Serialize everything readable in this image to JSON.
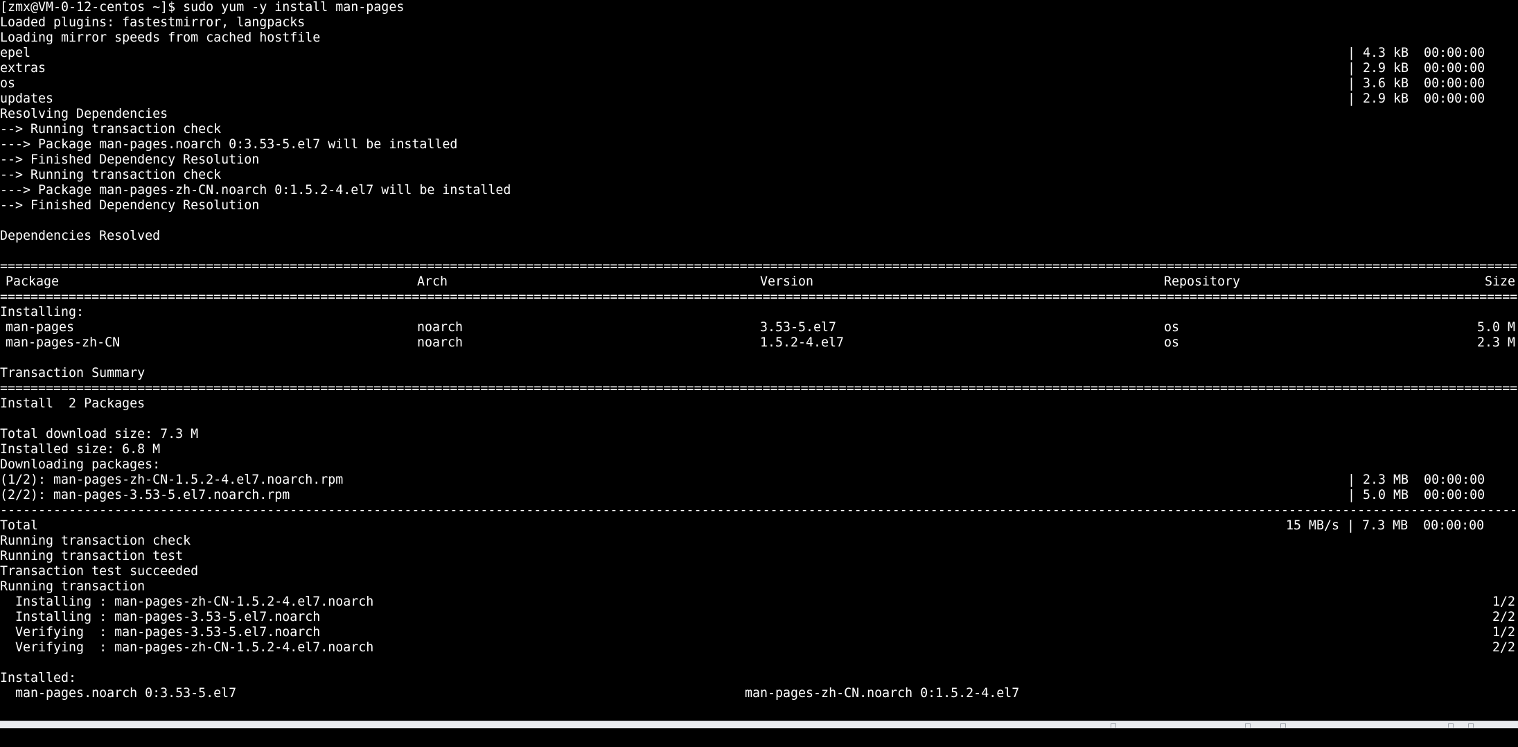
{
  "terminal": {
    "prompt": "[zmx@VM-0-12-centos ~]$ sudo yum -y install man-pages",
    "loaded_plugins": "Loaded plugins: fastestmirror, langpacks",
    "mirror_msg": "Loading mirror speeds from cached hostfile",
    "repos": [
      {
        "name": "epel",
        "stat": "| 4.3 kB  00:00:00"
      },
      {
        "name": "extras",
        "stat": "| 2.9 kB  00:00:00"
      },
      {
        "name": "os",
        "stat": "| 3.6 kB  00:00:00"
      },
      {
        "name": "updates",
        "stat": "| 2.9 kB  00:00:00"
      }
    ],
    "resolve": [
      "Resolving Dependencies",
      "--> Running transaction check",
      "---> Package man-pages.noarch 0:3.53-5.el7 will be installed",
      "--> Finished Dependency Resolution",
      "--> Running transaction check",
      "---> Package man-pages-zh-CN.noarch 0:1.5.2-4.el7 will be installed",
      "--> Finished Dependency Resolution"
    ],
    "deps_resolved": "Dependencies Resolved",
    "table": {
      "headers": {
        "package": "Package",
        "arch": "Arch",
        "version": "Version",
        "repository": "Repository",
        "size": "Size"
      },
      "installing_label": "Installing:",
      "rows": [
        {
          "package": "man-pages",
          "arch": "noarch",
          "version": "3.53-5.el7",
          "repository": "os",
          "size": "5.0 M"
        },
        {
          "package": "man-pages-zh-CN",
          "arch": "noarch",
          "version": "1.5.2-4.el7",
          "repository": "os",
          "size": "2.3 M"
        }
      ]
    },
    "summary_title": "Transaction Summary",
    "install_count": "Install  2 Packages",
    "total_download": "Total download size: 7.3 M",
    "installed_size": "Installed size: 6.8 M",
    "downloading": "Downloading packages:",
    "downloads": [
      {
        "name": "(1/2): man-pages-zh-CN-1.5.2-4.el7.noarch.rpm",
        "stat": "| 2.3 MB  00:00:00"
      },
      {
        "name": "(2/2): man-pages-3.53-5.el7.noarch.rpm",
        "stat": "| 5.0 MB  00:00:00"
      }
    ],
    "total": {
      "label": "Total",
      "stat": "15 MB/s | 7.3 MB  00:00:00"
    },
    "run_lines": [
      "Running transaction check",
      "Running transaction test",
      "Transaction test succeeded",
      "Running transaction"
    ],
    "steps": [
      {
        "text": "  Installing : man-pages-zh-CN-1.5.2-4.el7.noarch",
        "count": "1/2"
      },
      {
        "text": "  Installing : man-pages-3.53-5.el7.noarch",
        "count": "2/2"
      },
      {
        "text": "  Verifying  : man-pages-3.53-5.el7.noarch",
        "count": "1/2"
      },
      {
        "text": "  Verifying  : man-pages-zh-CN-1.5.2-4.el7.noarch",
        "count": "2/2"
      }
    ],
    "installed_label": "Installed:",
    "installed": [
      "  man-pages.noarch 0:3.53-5.el7",
      "man-pages-zh-CN.noarch 0:1.5.2-4.el7"
    ]
  },
  "colors": {
    "background": "#000000",
    "foreground": "#ffffff"
  }
}
